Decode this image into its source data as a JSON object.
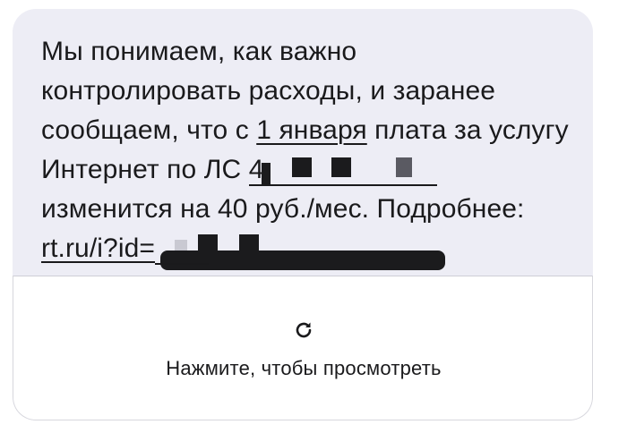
{
  "message": {
    "line1": "Мы понимаем, как важно",
    "line2": "контролировать расходы, и заранее",
    "line3_before": "сообщаем, что с ",
    "line3_link": "1 января",
    "line3_after": " плата за услугу",
    "line4_text": "Интернет по ЛС ",
    "line4_visible_digit": "4",
    "line5": "изменится на 40 руб./мес. Подробнее:",
    "line6_link": "rt.ru/i?id="
  },
  "action": {
    "icon": "refresh-icon",
    "label": "Нажмите, чтобы просмотреть"
  },
  "colors": {
    "bubble_background": "#ededf5",
    "text": "#1a1a1c",
    "panel_background": "#ffffff"
  }
}
